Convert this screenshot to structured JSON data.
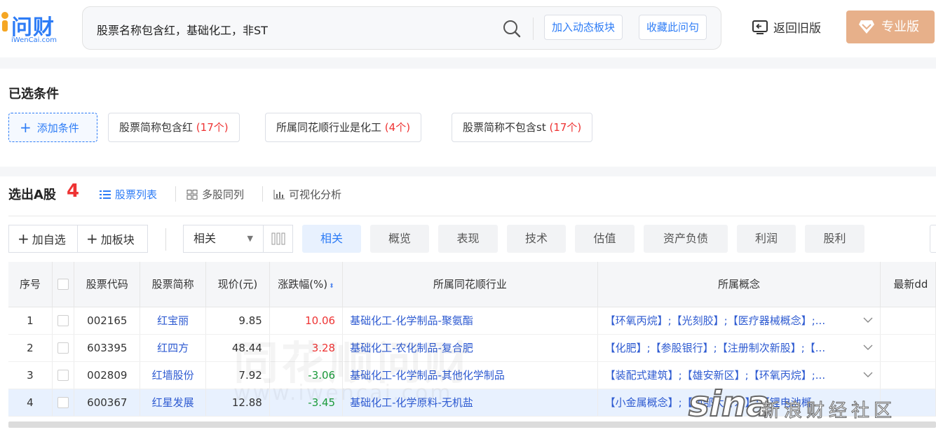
{
  "logo": {
    "cn": "问财",
    "en": "iWenCai.com"
  },
  "search": {
    "query": "股票名称包含红，基础化工，非ST",
    "add_dynamic": "加入动态板块",
    "collect": "收藏此问句"
  },
  "header": {
    "back_label": "返回旧版",
    "pro_label": "专业版"
  },
  "conditions": {
    "title": "已选条件",
    "add_label": "添加条件",
    "items": [
      {
        "text": "股票简称包含红",
        "count": "(17个)"
      },
      {
        "text": "所属同花顺行业是化工",
        "count": "(4个)"
      },
      {
        "text": "股票简称不包含st",
        "count": "(17个)"
      }
    ]
  },
  "result": {
    "title": "选出A股",
    "count": "4",
    "views": [
      "股票列表",
      "多股同列",
      "可视化分析"
    ]
  },
  "toolbar": {
    "add_watch": "加自选",
    "add_block": "加板块",
    "sort_select": "相关",
    "tabs": [
      "相关",
      "概览",
      "表现",
      "技术",
      "估值",
      "资产负债",
      "利润",
      "股利"
    ]
  },
  "table": {
    "headers": [
      "序号",
      "",
      "股票代码",
      "股票简称",
      "现价(元)",
      "涨跌幅(%)",
      "所属同花顺行业",
      "所属概念",
      "最新dd"
    ],
    "rows": [
      {
        "idx": "1",
        "code": "002165",
        "name": "红宝丽",
        "price": "9.85",
        "change": "10.06",
        "dir": "up",
        "industry": "基础化工-化学制品-聚氨酯",
        "concept": "【环氧丙烷】;【光刻胶】;【医疗器械概念】;..."
      },
      {
        "idx": "2",
        "code": "603395",
        "name": "红四方",
        "price": "48.44",
        "change": "3.28",
        "dir": "up",
        "industry": "基础化工-农化制品-复合肥",
        "concept": "【化肥】;【参股银行】;【注册制次新股】;【..."
      },
      {
        "idx": "3",
        "code": "002809",
        "name": "红墙股份",
        "price": "7.92",
        "change": "-3.06",
        "dir": "down",
        "industry": "基础化工-化学制品-其他化学制品",
        "concept": "【装配式建筑】;【雄安新区】;【环氧丙烷】;..."
      },
      {
        "idx": "4",
        "code": "600367",
        "name": "红星发展",
        "price": "12.88",
        "change": "-3.45",
        "dir": "down",
        "industry": "基础化工-化学原料-无机盐",
        "concept": "【小金属概念】;【西部大开发】;【锂电池概..."
      }
    ]
  },
  "watermark": {
    "cn": "同花顺问财",
    "en": "www.iwencai.com"
  },
  "sina": {
    "logo": "sina",
    "text": "新浪财经社区"
  },
  "colors": {
    "accent": "#2d7cf6",
    "up": "#e33333",
    "down": "#1a9a3a",
    "pro": "#e7b08a"
  }
}
